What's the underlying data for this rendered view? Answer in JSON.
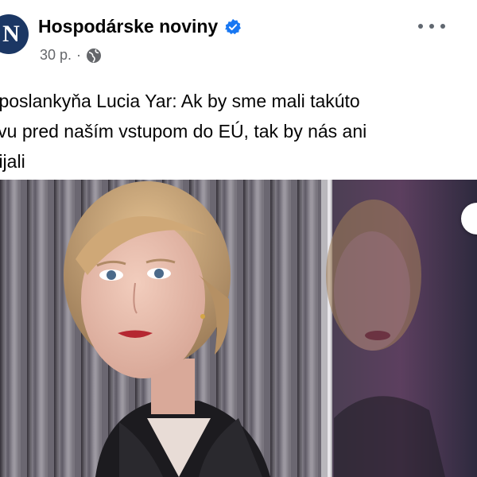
{
  "post": {
    "page_name": "Hospodárske noviny",
    "avatar_letter": "N",
    "time": "30 p.",
    "separator": "·",
    "text": "roposlankyňa Lucia Yar: Ak by sme mali takúto\ntavu pred naším vstupom do EÚ, tak by nás ani\nprijali"
  },
  "icons": {
    "verified": "verified-badge-icon",
    "audience": "globe-icon",
    "more": "more-options-icon"
  },
  "colors": {
    "brand_avatar": "#1b3764",
    "verified": "#1877f2",
    "meta_text": "#65676b"
  }
}
